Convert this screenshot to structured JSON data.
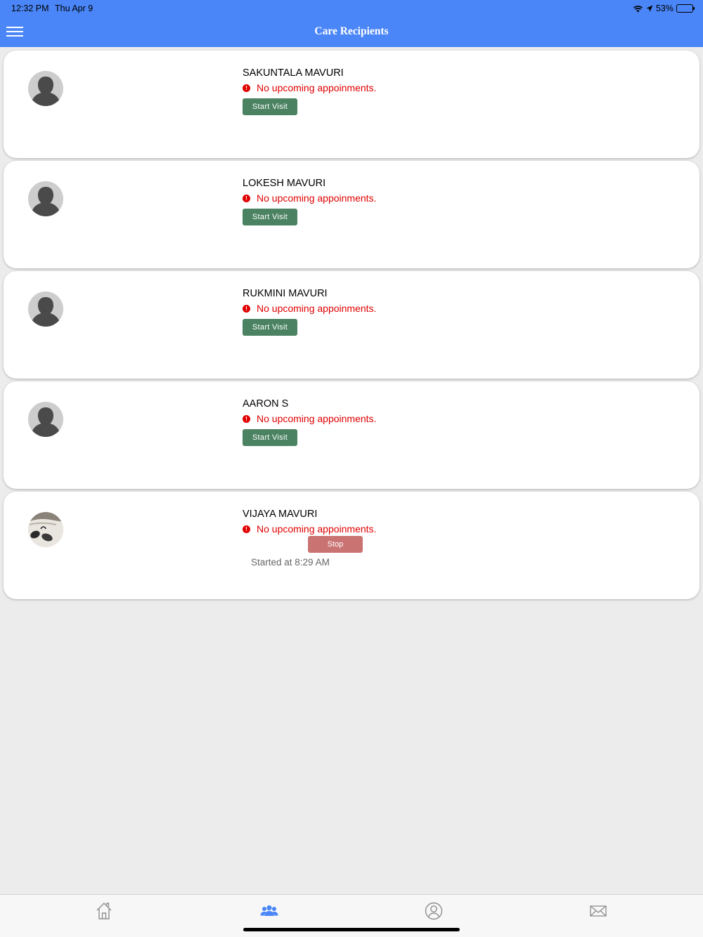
{
  "status_bar": {
    "time": "12:32 PM",
    "date": "Thu Apr 9",
    "battery": "53%",
    "battery_level": 0.53
  },
  "header": {
    "title": "Care Recipients",
    "menu_icon": "hamburger-menu-icon"
  },
  "recipients": [
    {
      "name": "SAKUNTALA MAVURI",
      "appointment": "No upcoming appoinments.",
      "action": "Start Visit"
    },
    {
      "name": "LOKESH MAVURI",
      "appointment": "No upcoming appoinments.",
      "action": "Start Visit"
    },
    {
      "name": "RUKMINI MAVURI",
      "appointment": "No upcoming appoinments.",
      "action": "Start Visit"
    },
    {
      "name": "AARON S",
      "appointment": "No upcoming appoinments.",
      "action": "Start Visit"
    },
    {
      "name": "VIJAYA MAVURI",
      "appointment": "No upcoming appoinments.",
      "action": "Stop",
      "started": "Started at 8:29 AM"
    }
  ],
  "tabs": [
    {
      "icon": "home-icon",
      "active": false
    },
    {
      "icon": "group-icon",
      "active": true
    },
    {
      "icon": "profile-icon",
      "active": false
    },
    {
      "icon": "mail-icon",
      "active": false
    }
  ],
  "colors": {
    "header": "#4a86f7",
    "start_button": "#4b8362",
    "stop_button": "#c97373",
    "alert": "#e00000",
    "active_tab": "#4a86f7"
  }
}
